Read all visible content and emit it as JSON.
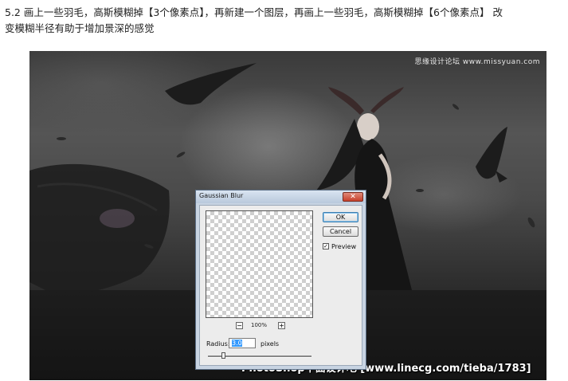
{
  "caption": {
    "line1": "5.2 画上一些羽毛，高斯模糊掉【3个像素点】，再新建一个图层，再画上一些羽毛，高斯模糊掉【6个像素点】 改",
    "line2": "变模糊半径有助于增加景深的感觉"
  },
  "photo": {
    "logo_text": "思缘设计论坛 www.missyuan.com",
    "watermark": "PhotoShop平面设计吧 [www.linecg.com/tieba/1783]"
  },
  "dialog": {
    "title": "Gaussian Blur",
    "close_icon": "close-icon",
    "ok_label": "OK",
    "cancel_label": "Cancel",
    "preview_label": "Preview",
    "preview_checked": true,
    "zoom_out_label": "−",
    "zoom_in_label": "+",
    "zoom_level": "100%",
    "radius_label": "Radius:",
    "radius_value": "3.0",
    "radius_unit": "pixels"
  },
  "colors": {
    "dialog_frame": "#c8d4e2",
    "close_button": "#c7402b",
    "selection": "#3399ff"
  }
}
